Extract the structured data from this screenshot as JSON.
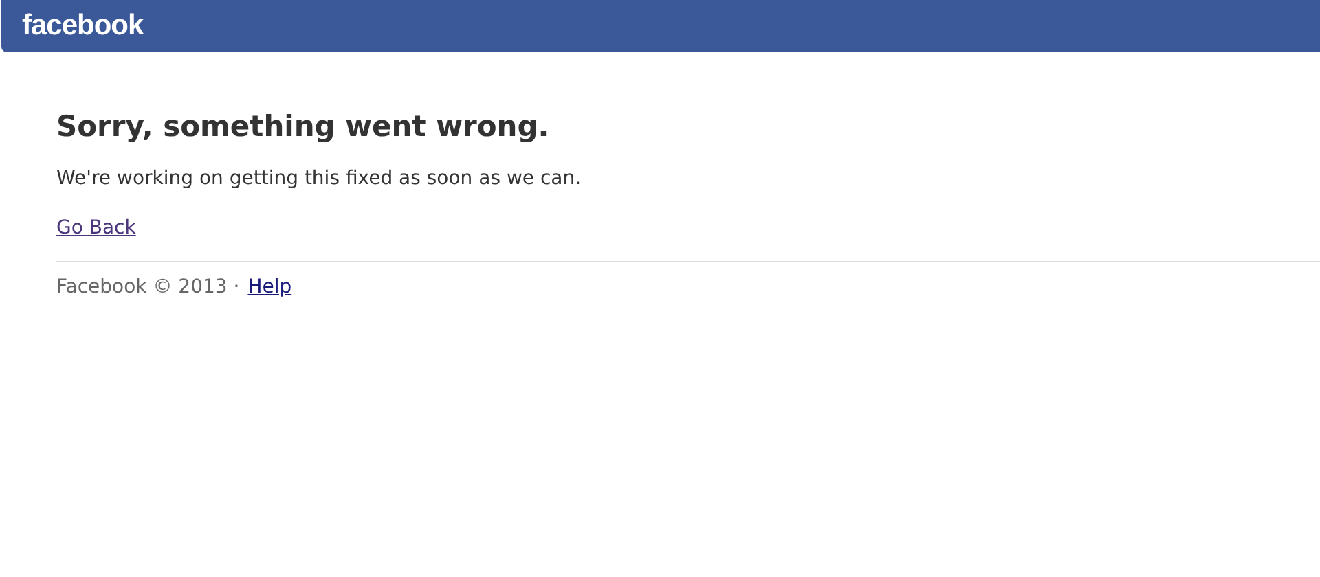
{
  "header": {
    "logo": "facebook"
  },
  "error": {
    "title": "Sorry, something went wrong.",
    "message": "We're working on getting this fixed as soon as we can.",
    "link": "Go Back"
  },
  "footer": {
    "copyright": "Facebook © 2013 ·",
    "link": "Help"
  }
}
